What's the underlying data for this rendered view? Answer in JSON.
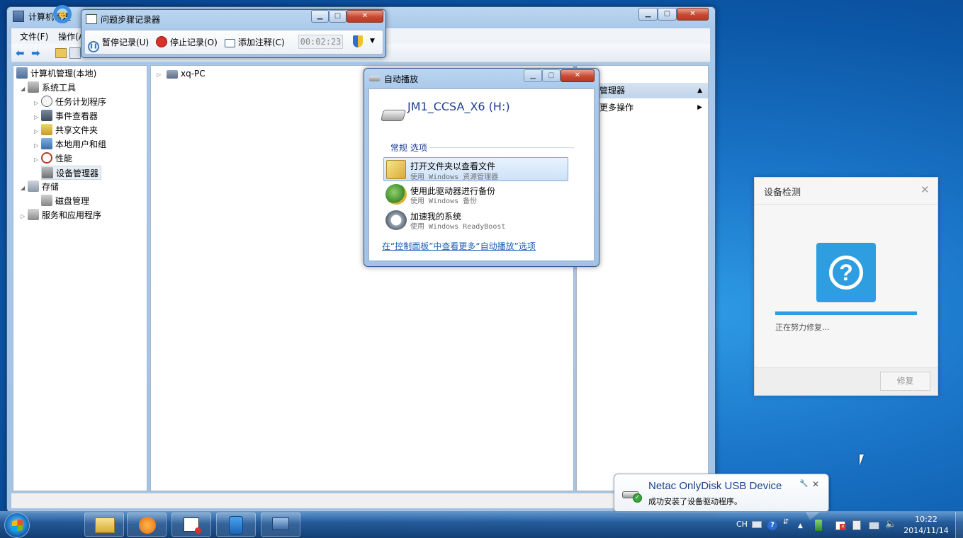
{
  "comp_mgmt": {
    "title": "计算机管理",
    "menu": [
      "文件(F)",
      "操作(A)"
    ],
    "tree": {
      "root": "计算机管理(本地)",
      "system_tools": "系统工具",
      "task_scheduler": "任务计划程序",
      "event_viewer": "事件查看器",
      "shared_folders": "共享文件夹",
      "local_users": "本地用户和组",
      "performance": "性能",
      "device_manager": "设备管理器",
      "storage": "存储",
      "disk_mgmt": "磁盘管理",
      "services_apps": "服务和应用程序"
    },
    "center": {
      "node": "xq-PC"
    },
    "actions": {
      "header": "管理器",
      "more": "更多操作"
    }
  },
  "psr": {
    "title": "问题步骤记录器",
    "pause": "暂停记录(U)",
    "stop": "停止记录(O)",
    "comment": "添加注释(C)",
    "time": "00:02:23"
  },
  "autoplay": {
    "title": "自动播放",
    "drive": "JM1_CCSA_X6 (H:)",
    "section": "常规 选项",
    "options": [
      {
        "label": "打开文件夹以查看文件",
        "sub": "使用 Windows 资源管理器"
      },
      {
        "label": "使用此驱动器进行备份",
        "sub": "使用 Windows 备份"
      },
      {
        "label": "加速我的系统",
        "sub": "使用 Windows ReadyBoost"
      }
    ],
    "link": "在“控制面板”中查看更多“自动播放”选项"
  },
  "detect": {
    "title": "设备检测",
    "status": "正在努力修复...",
    "button": "修复",
    "progress": 1.0,
    "accent": "#2e9ee0"
  },
  "balloon": {
    "title": "Netac OnlyDisk USB Device",
    "message": "成功安装了设备驱动程序。"
  },
  "taskbar": {
    "lang": "CH",
    "time": "10:22",
    "date": "2014/11/14"
  }
}
